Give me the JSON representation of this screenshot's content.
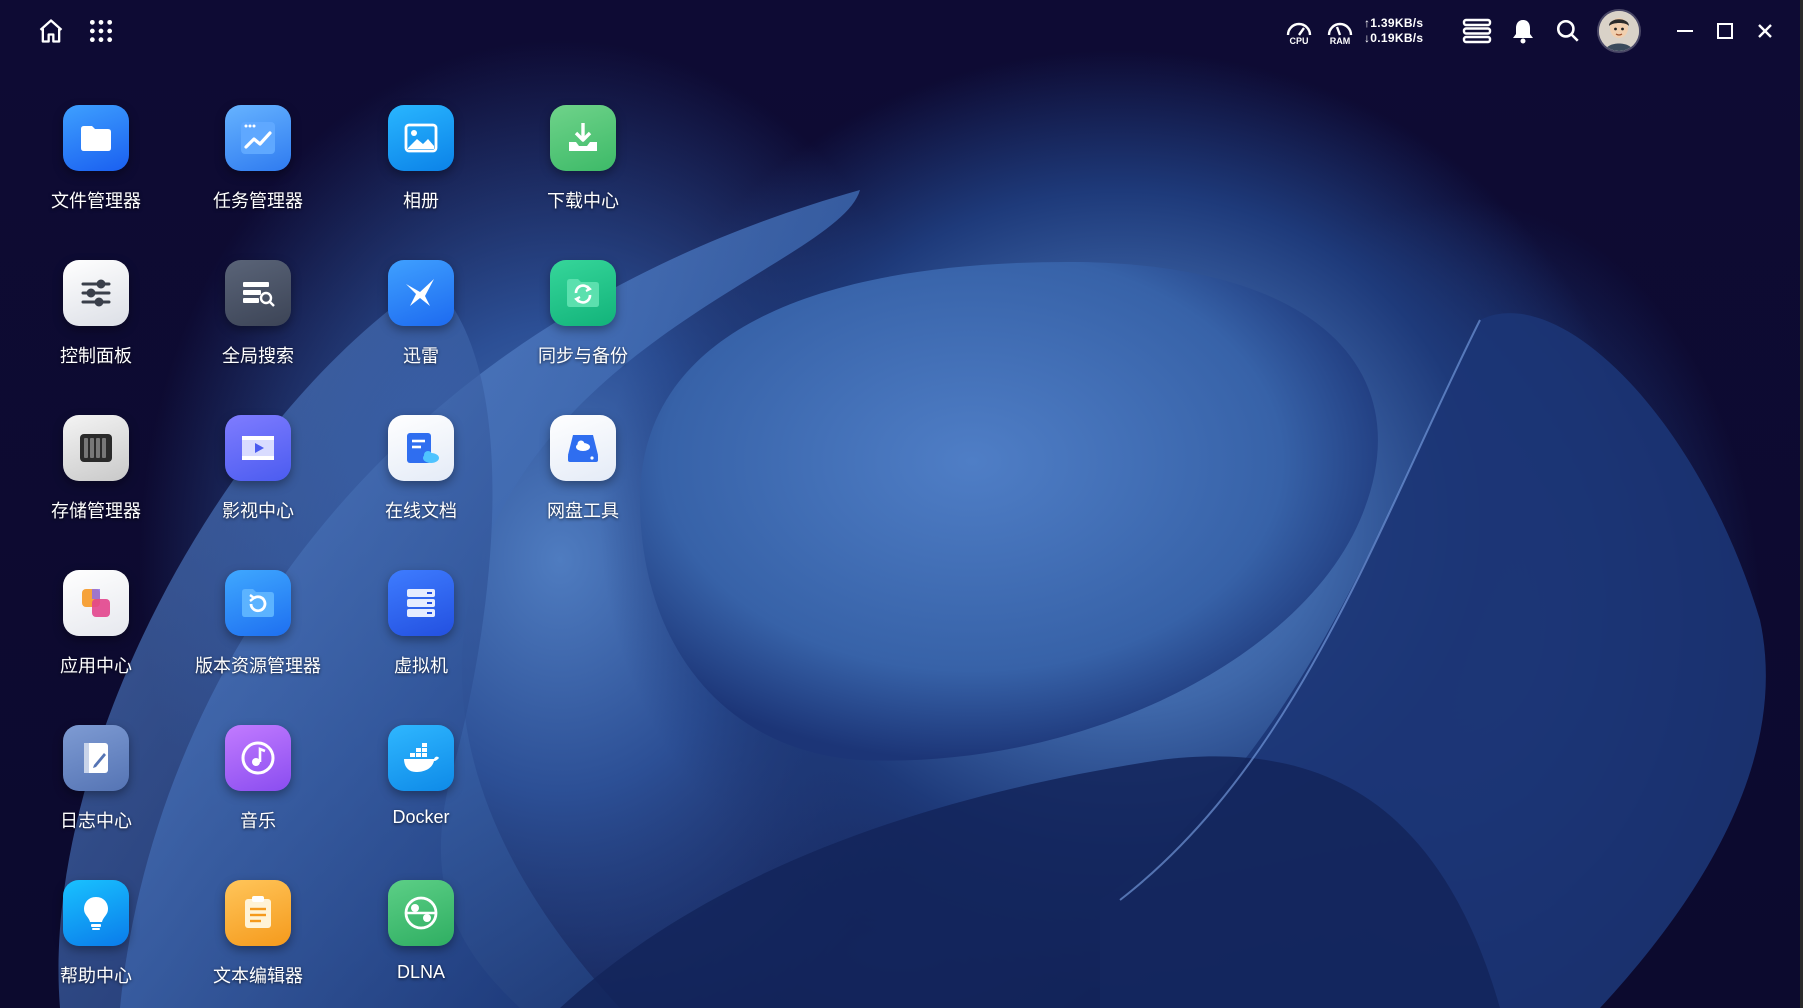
{
  "topbar": {
    "net_up": "↑1.39KB/s",
    "net_down": "↓0.19KB/s",
    "cpu_label": "CPU",
    "ram_label": "RAM",
    "icons": [
      "home-icon",
      "apps-grid-icon",
      "cpu-gauge-icon",
      "ram-gauge-icon",
      "server-list-icon",
      "bell-icon",
      "search-icon",
      "avatar",
      "minimize-icon",
      "maximize-icon",
      "close-icon"
    ]
  },
  "colors": {
    "accent": "#3b82f6",
    "bg": "#0c0a2e"
  },
  "apps": [
    {
      "id": "file-manager",
      "label": "文件管理器"
    },
    {
      "id": "task-manager",
      "label": "任务管理器"
    },
    {
      "id": "photos",
      "label": "相册"
    },
    {
      "id": "download-center",
      "label": "下载中心"
    },
    {
      "id": "control-panel",
      "label": "控制面板"
    },
    {
      "id": "global-search",
      "label": "全局搜索"
    },
    {
      "id": "thunder",
      "label": "迅雷"
    },
    {
      "id": "sync-backup",
      "label": "同步与备份"
    },
    {
      "id": "storage-manager",
      "label": "存储管理器"
    },
    {
      "id": "video-center",
      "label": "影视中心"
    },
    {
      "id": "online-docs",
      "label": "在线文档"
    },
    {
      "id": "cloud-drive-tool",
      "label": "网盘工具"
    },
    {
      "id": "app-center",
      "label": "应用中心"
    },
    {
      "id": "version-manager",
      "label": "版本资源管理器"
    },
    {
      "id": "virtual-machine",
      "label": "虚拟机"
    },
    {
      "id": "log-center",
      "label": "日志中心"
    },
    {
      "id": "music",
      "label": "音乐"
    },
    {
      "id": "docker",
      "label": "Docker"
    },
    {
      "id": "help-center",
      "label": "帮助中心"
    },
    {
      "id": "text-editor",
      "label": "文本编辑器"
    },
    {
      "id": "dlna",
      "label": "DLNA"
    }
  ]
}
